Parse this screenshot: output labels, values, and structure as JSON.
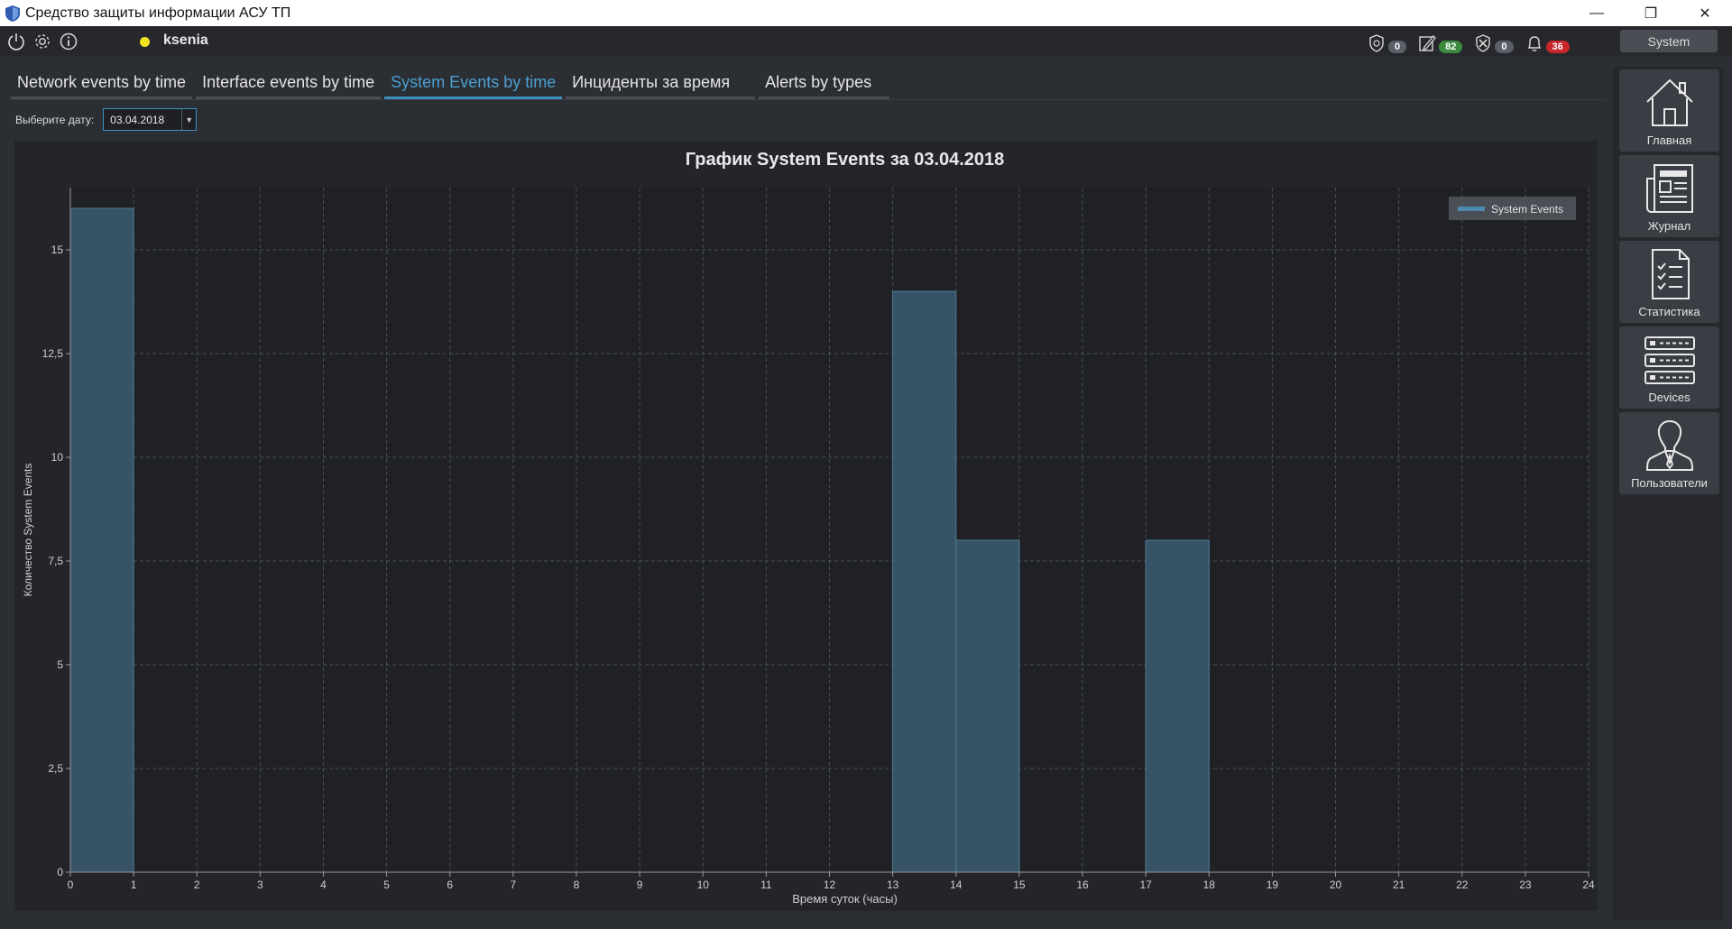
{
  "window": {
    "title": "Средство защиты информации АСУ ТП",
    "minimize": "—",
    "maximize": "❐",
    "close": "✕"
  },
  "toolbar": {
    "username": "ksenia",
    "status_color": "#f2e21d",
    "counters": [
      {
        "icon": "shield-icon",
        "value": "0",
        "color": "#5a6068"
      },
      {
        "icon": "edit-icon",
        "value": "82",
        "color": "#3c8b3f"
      },
      {
        "icon": "tools-icon",
        "value": "0",
        "color": "#5a6068"
      },
      {
        "icon": "bell-icon",
        "value": "36",
        "color": "#c8262b"
      }
    ],
    "system_button": "System"
  },
  "tabs": [
    {
      "label": "Network events by time",
      "active": false
    },
    {
      "label": "Interface events by time",
      "active": false
    },
    {
      "label": "System Events by time",
      "active": true
    },
    {
      "label": "Инциденты за время",
      "active": false
    },
    {
      "label": "Alerts by types",
      "active": false
    }
  ],
  "date_picker": {
    "label": "Выберите дату:",
    "value": "03.04.2018"
  },
  "nav": [
    {
      "label": "Главная",
      "icon": "home-icon"
    },
    {
      "label": "Журнал",
      "icon": "journal-icon"
    },
    {
      "label": "Статистика",
      "icon": "checklist-icon"
    },
    {
      "label": "Devices",
      "icon": "server-icon"
    },
    {
      "label": "Пользователи",
      "icon": "user-icon"
    }
  ],
  "chart_data": {
    "type": "bar",
    "title": "График System Events за 03.04.2018",
    "xlabel": "Время суток (часы)",
    "ylabel": "Количество System Events",
    "xlim": [
      0,
      24
    ],
    "ylim": [
      0,
      16.5
    ],
    "xticks": [
      "0",
      "1",
      "2",
      "3",
      "4",
      "5",
      "6",
      "7",
      "8",
      "9",
      "10",
      "11",
      "12",
      "13",
      "14",
      "15",
      "16",
      "17",
      "18",
      "19",
      "20",
      "21",
      "22",
      "23",
      "24"
    ],
    "yticks": [
      {
        "value": 0,
        "label": "0"
      },
      {
        "value": 2.5,
        "label": "2,5"
      },
      {
        "value": 5,
        "label": "5"
      },
      {
        "value": 7.5,
        "label": "7,5"
      },
      {
        "value": 10,
        "label": "10"
      },
      {
        "value": 12.5,
        "label": "12,5"
      },
      {
        "value": 15,
        "label": "15"
      }
    ],
    "bars": [
      {
        "x_start": 0,
        "x_end": 1,
        "value": 16
      },
      {
        "x_start": 13,
        "x_end": 14,
        "value": 14
      },
      {
        "x_start": 14,
        "x_end": 15,
        "value": 8
      },
      {
        "x_start": 17,
        "x_end": 18,
        "value": 8
      }
    ],
    "series": [
      {
        "name": "System Events",
        "color": "#375466"
      }
    ],
    "legend": "top-right",
    "grid": true
  }
}
